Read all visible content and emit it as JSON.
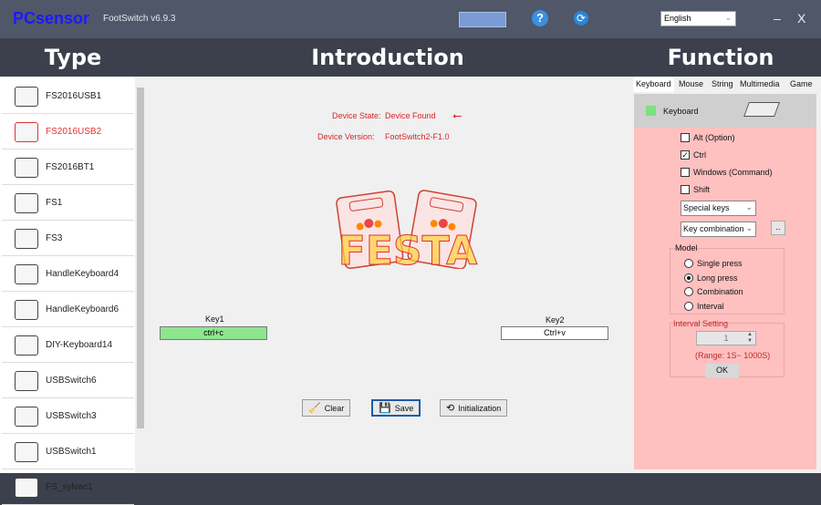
{
  "titlebar": {
    "logo": "PCsensor",
    "title": "FootSwitch v6.9.3",
    "language": "English",
    "minimize": "–",
    "close": "X",
    "help": "?",
    "refresh": "⟳"
  },
  "headers": {
    "type": "Type",
    "introduction": "Introduction",
    "function": "Function"
  },
  "types": [
    {
      "label": "FS2016USB1"
    },
    {
      "label": "FS2016USB2",
      "selected": true
    },
    {
      "label": "FS2016BT1"
    },
    {
      "label": "FS1"
    },
    {
      "label": "FS3"
    },
    {
      "label": "HandleKeyboard4"
    },
    {
      "label": "HandleKeyboard6"
    },
    {
      "label": "DIY-Keyboard14"
    },
    {
      "label": "USBSwitch6"
    },
    {
      "label": "USBSwitch3"
    },
    {
      "label": "USBSwitch1"
    },
    {
      "label": "FS_sylvac1"
    }
  ],
  "device": {
    "state_label": "Device State:",
    "state_value": "Device Found",
    "version_label": "Device Version:",
    "version_value": "FootSwitch2-F1.0",
    "watermark": "FESTA"
  },
  "keys": [
    {
      "label": "Key1",
      "value": "ctrl+c",
      "active": true
    },
    {
      "label": "Key2",
      "value": "Ctrl+v",
      "active": false
    }
  ],
  "buttons": {
    "clear": "Clear",
    "save": "Save",
    "init": "Initialization"
  },
  "function": {
    "tabs": [
      "Keyboard",
      "Mouse",
      "String",
      "Multimedia",
      "Game"
    ],
    "active_tab": "Keyboard",
    "mode_label": "Keyboard",
    "modifiers": [
      {
        "label": "Alt (Option)",
        "checked": false
      },
      {
        "label": "Ctrl",
        "checked": true
      },
      {
        "label": "Windows (Command)",
        "checked": false
      },
      {
        "label": "Shift",
        "checked": false
      }
    ],
    "special_keys": "Special keys",
    "key_combination": "Key combination",
    "more": "..",
    "model_label": "Model",
    "models": [
      {
        "label": "Single press",
        "selected": false
      },
      {
        "label": "Long press",
        "selected": true
      },
      {
        "label": "Combination",
        "selected": false
      },
      {
        "label": "Interval",
        "selected": false
      }
    ],
    "interval_label": "Interval Setting",
    "interval_value": "1",
    "range": "(Range: 1S~ 1000S)",
    "ok": "OK"
  },
  "colors": {
    "pink": "#ffc0c0",
    "accent_red": "#d6262a",
    "key_active": "#8ee68e"
  }
}
